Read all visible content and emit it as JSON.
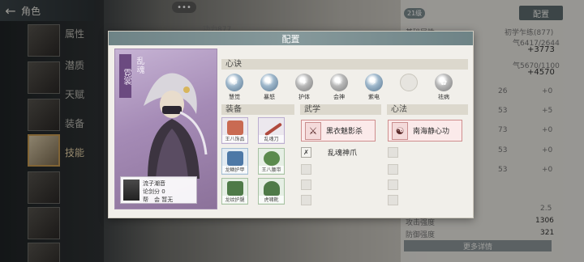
{
  "background": {
    "header_title": "角色",
    "side_tabs": [
      "属性",
      "潜质",
      "天赋",
      "装备",
      "技能"
    ],
    "right_panel": {
      "level_pill": "21级",
      "config_button": "配置",
      "base_attr_label": "基础属性",
      "sect_text": "初学乍练(877)",
      "top_label": "功力877",
      "stat_a": "气6417/2644",
      "stat_a_delta": "+3773",
      "stat_b": "气5670/1100",
      "stat_b_delta": "+4570",
      "rows": [
        {
          "value": "26",
          "delta": "+0"
        },
        {
          "value": "53",
          "delta": "+5"
        },
        {
          "value": "73",
          "delta": "+0"
        },
        {
          "value": "53",
          "delta": "+0"
        },
        {
          "value": "53",
          "delta": "+0"
        }
      ],
      "small_value": "2.5",
      "attack_label": "攻击强度",
      "attack_value": "1306",
      "defense_label": "防御强度",
      "defense_value": "321",
      "more_button": "更多详情"
    },
    "top_dots": "•••"
  },
  "modal": {
    "title": "配置",
    "character": {
      "name": "霓裳",
      "title": "乱魂",
      "info_line1": "流子潮音",
      "info_line2": "论剑分 0",
      "info_line3": "帮　会 暂无"
    },
    "xinjue": {
      "header": "心诀",
      "items": [
        {
          "label": "慧觉",
          "icon": "spirit-icon"
        },
        {
          "label": "暴怒",
          "icon": "rage-icon"
        },
        {
          "label": "护体",
          "icon": "shield-icon"
        },
        {
          "label": "会神",
          "icon": "focus-icon"
        },
        {
          "label": "紫电",
          "icon": "lightning-icon"
        },
        {
          "label": "",
          "icon": "empty-slot-icon"
        },
        {
          "label": "祛病",
          "icon": "cure-icon"
        }
      ]
    },
    "equipment": {
      "header": "装备",
      "items": [
        {
          "label": "王八饰品",
          "color": "#c96a52"
        },
        {
          "label": "乱魂刀",
          "color": "#b04a3e"
        },
        {
          "label": "龙鳞护甲",
          "color": "#4d78a6"
        },
        {
          "label": "王八腰带",
          "color": "#5a8a4d"
        },
        {
          "label": "龙纹护腿",
          "color": "#4f7a48"
        },
        {
          "label": "虎啸靴",
          "color": "#4f7a48"
        }
      ]
    },
    "martial": {
      "header": "武学",
      "main_skill": "黑衣魅影杀",
      "sub_skill": "乱魂神爪"
    },
    "heart": {
      "header": "心法",
      "main_skill": "南海静心功"
    }
  }
}
